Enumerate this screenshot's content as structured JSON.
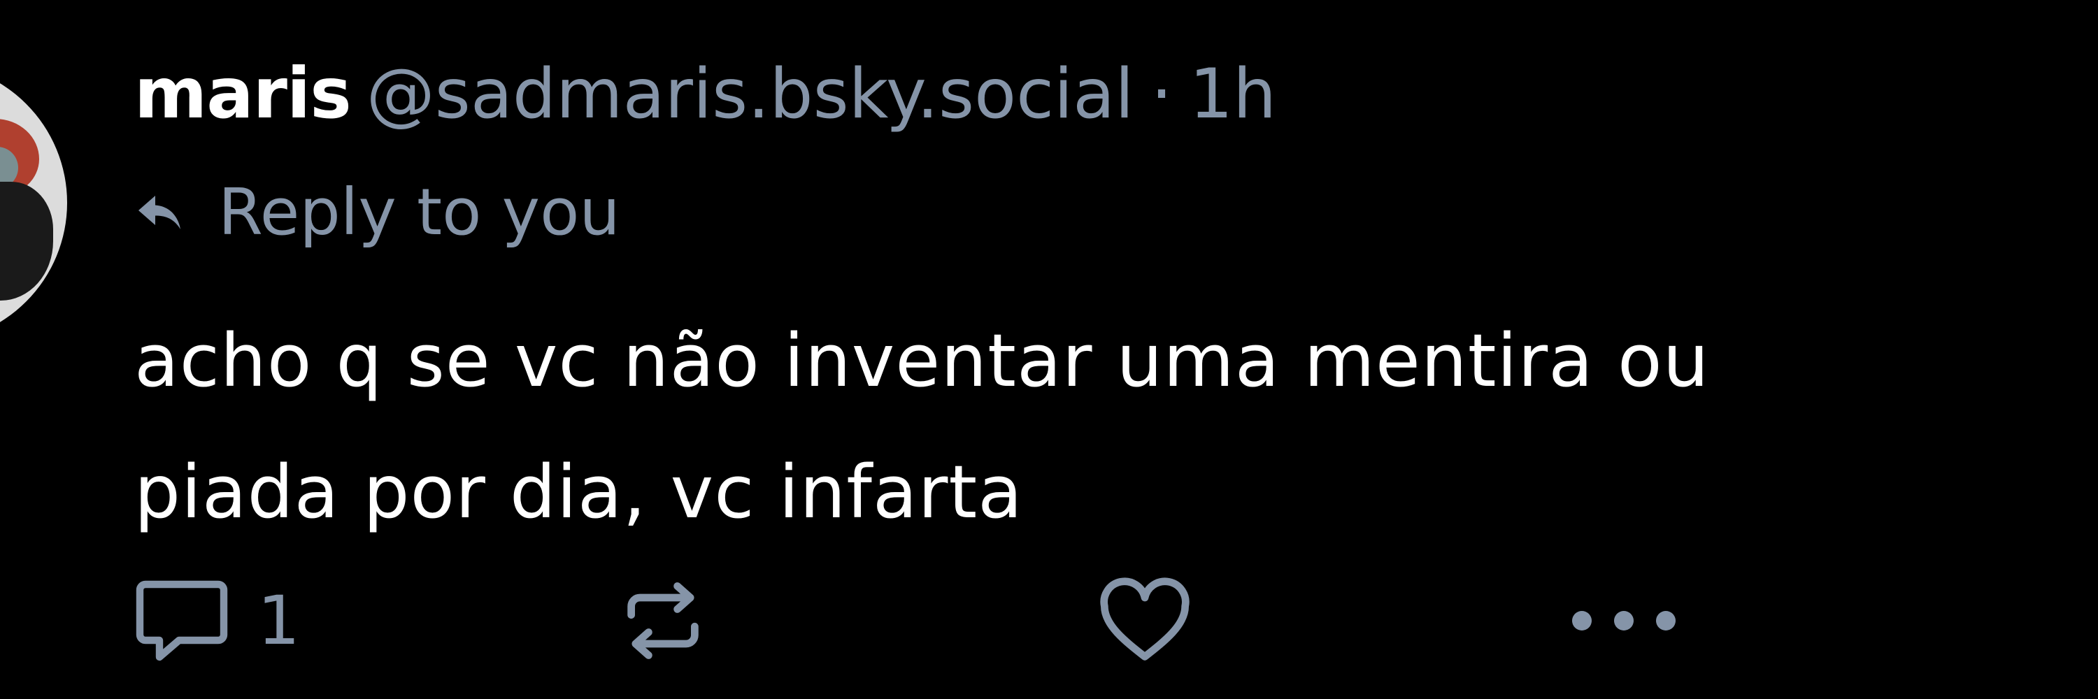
{
  "post": {
    "author": {
      "display_name": "maris",
      "handle": "@sadmaris.bsky.social",
      "separator": "·",
      "time": "1h"
    },
    "reply_context": {
      "icon": "reply-arrow-icon",
      "label": "Reply to you"
    },
    "text_lines": [
      "acho q se vc não inventar uma mentira ou",
      "piada por dia, vc infarta"
    ],
    "actions": {
      "reply": {
        "icon": "comment-icon",
        "count": "1"
      },
      "repost": {
        "icon": "repost-icon"
      },
      "like": {
        "icon": "heart-icon"
      },
      "more": {
        "icon": "more-dots-icon"
      }
    }
  },
  "colors": {
    "background": "#000000",
    "primary_text": "#ffffff",
    "secondary_text": "#8594a8"
  }
}
